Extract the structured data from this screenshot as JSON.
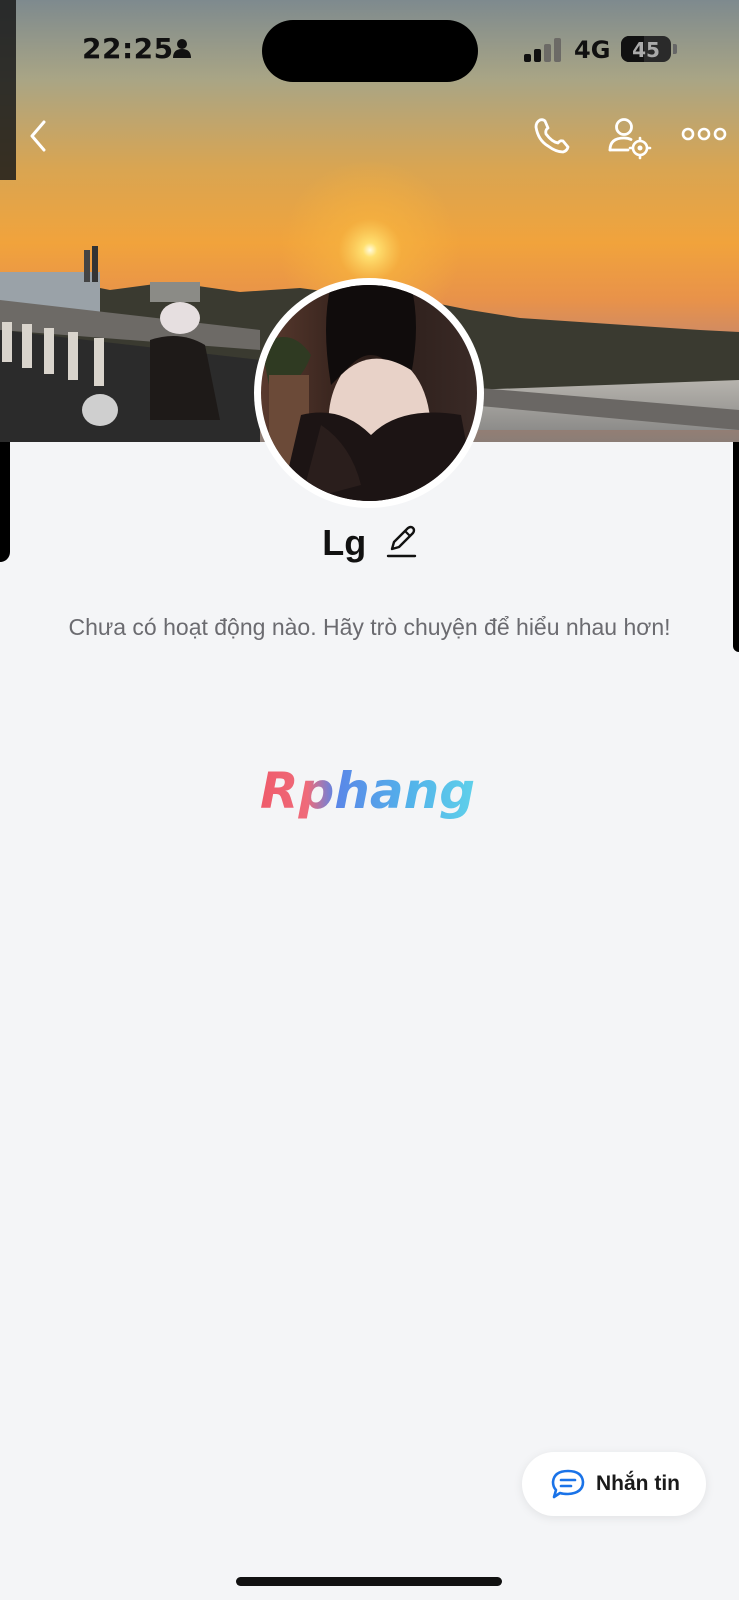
{
  "status_bar": {
    "time": "22:25",
    "network": "4G",
    "battery": "45",
    "battery_level": 0.45
  },
  "nav": {
    "back_icon": "chevron-left-icon",
    "call_icon": "phone-icon",
    "profile_settings_icon": "user-gear-icon",
    "more_icon": "ellipsis-icon"
  },
  "profile": {
    "name": "Lg",
    "empty_activity_text": "Chưa có hoạt động nào. Hãy trò chuyện để hiểu nhau hơn!"
  },
  "watermark": {
    "text": "Rphang"
  },
  "actions": {
    "message_label": "Nhắn tin",
    "message_icon": "chat-bubble-icon"
  },
  "colors": {
    "background": "#f4f5f7",
    "accent_blue": "#1a73e8",
    "text_primary": "#111111",
    "text_secondary": "#6b6b70"
  }
}
